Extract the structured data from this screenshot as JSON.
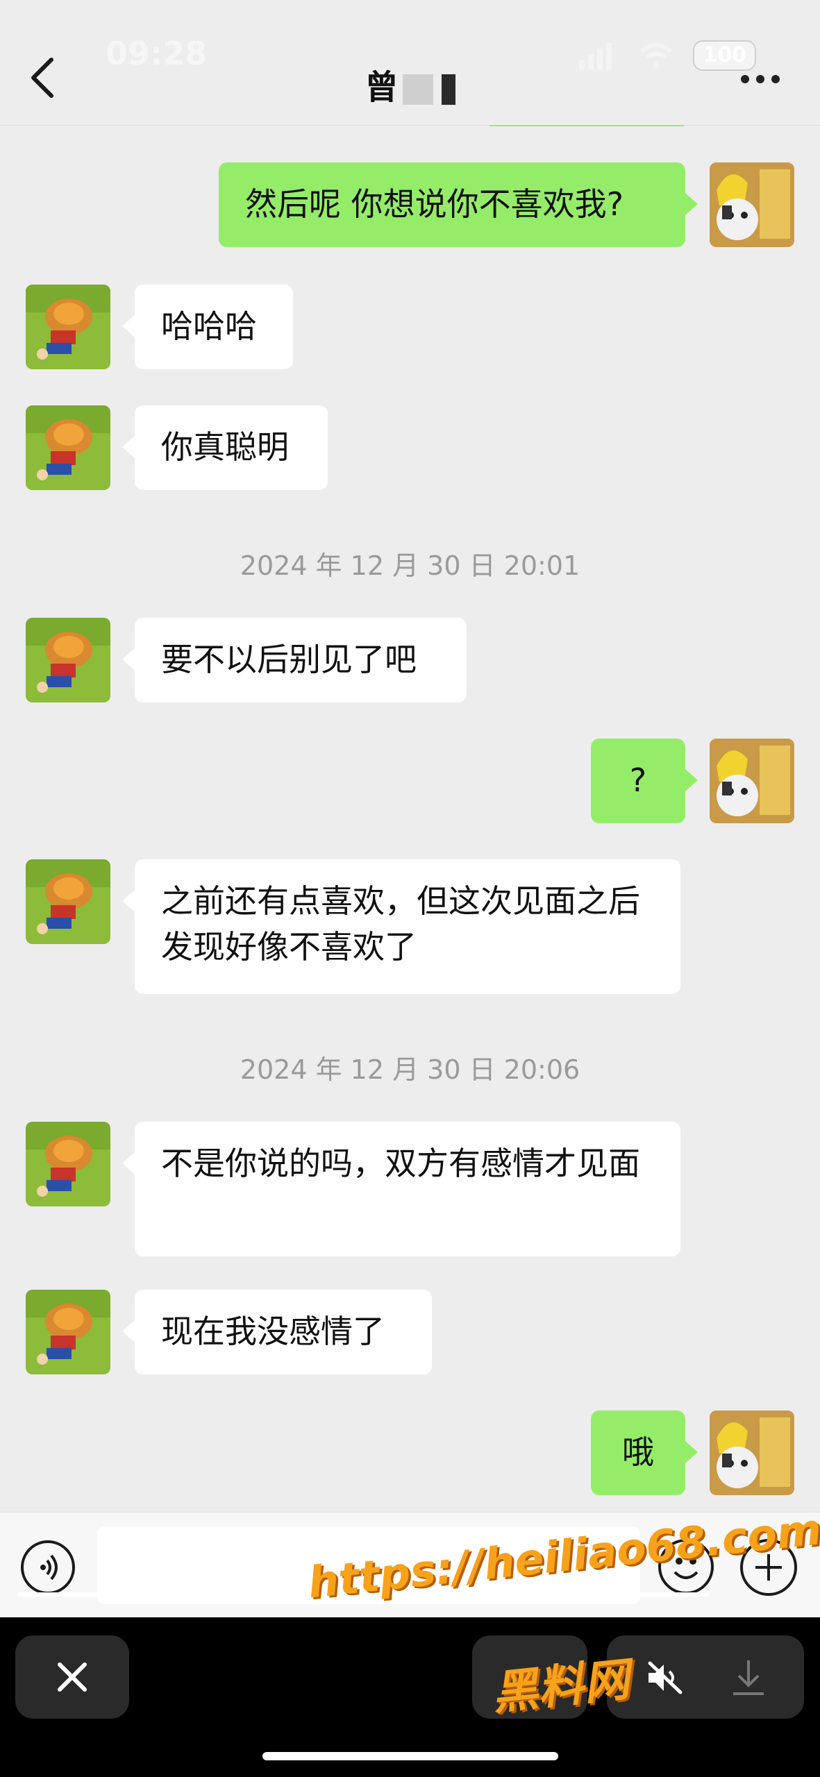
{
  "status_bar": {
    "time": "09:28",
    "battery": "100"
  },
  "header": {
    "title": "曾"
  },
  "messages": [
    {
      "side": "right",
      "text": "然后呢 你想说你不喜欢我?"
    },
    {
      "side": "left",
      "text": "哈哈哈"
    },
    {
      "side": "left",
      "text": "你真聪明"
    },
    {
      "type": "timestamp",
      "text": "2024 年 12 月 30 日 20:01"
    },
    {
      "side": "left",
      "text": "要不以后别见了吧"
    },
    {
      "side": "right",
      "text": "?"
    },
    {
      "side": "left",
      "text": "之前还有点喜欢，但这次见面之后发现好像不喜欢了"
    },
    {
      "type": "timestamp",
      "text": "2024 年 12 月 30 日 20:06"
    },
    {
      "side": "left",
      "text": "不是你说的吗，双方有感情才见面"
    },
    {
      "side": "left",
      "text": "现在我没感情了"
    },
    {
      "side": "right",
      "text": "哦"
    }
  ],
  "input_bar": {
    "placeholder": ""
  },
  "watermark": {
    "url": "https://heiliao68.com",
    "site_name": "黑料网"
  },
  "colors": {
    "bubble_self": "#95ec69",
    "bubble_other": "#ffffff",
    "background": "#ededed",
    "watermark": "#f7a21b"
  },
  "icons": {
    "header_left": "back-chevron-icon",
    "header_right": "more-dots-icon",
    "input_left": "voice-icon",
    "input_right": [
      "emoji-icon",
      "plus-icon"
    ],
    "overlay": [
      "close-icon",
      "mute-icon",
      "download-icon"
    ]
  }
}
